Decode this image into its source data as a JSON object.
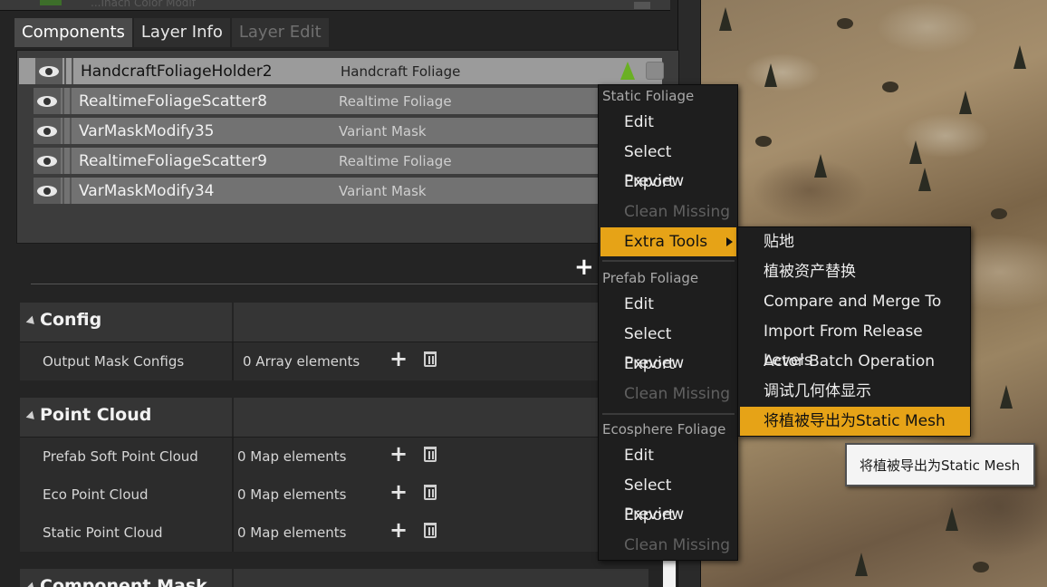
{
  "topbar": {
    "ghost_text": "...Inach Color Modif"
  },
  "tabs": [
    {
      "label": "Components",
      "state": "active"
    },
    {
      "label": "Layer Info",
      "state": "normal"
    },
    {
      "label": "Layer Edit",
      "state": "disabled"
    }
  ],
  "components": [
    {
      "name": "HandcraftFoliageHolder2",
      "type": "Handcraft Foliage",
      "selected": true
    },
    {
      "name": "RealtimeFoliageScatter8",
      "type": "Realtime Foliage"
    },
    {
      "name": "VarMaskModify35",
      "type": "Variant Mask"
    },
    {
      "name": "RealtimeFoliageScatter9",
      "type": "Realtime Foliage"
    },
    {
      "name": "VarMaskModify34",
      "type": "Variant Mask"
    }
  ],
  "sections": {
    "config": {
      "title": "Config",
      "rows": [
        {
          "label": "Output Mask Configs",
          "value": "0 Array elements"
        }
      ]
    },
    "point_cloud": {
      "title": "Point Cloud",
      "rows": [
        {
          "label": "Prefab Soft Point Cloud",
          "value": "0 Map elements"
        },
        {
          "label": "Eco Point Cloud",
          "value": "0 Map elements"
        },
        {
          "label": "Static Point Cloud",
          "value": "0 Map elements"
        }
      ]
    },
    "component_mask": {
      "title": "Component Mask"
    }
  },
  "context_menu": {
    "static_foliage": {
      "header": "Static Foliage",
      "items": [
        "Edit",
        "Select Preview",
        "Export",
        "Clean Missing",
        "Extra Tools"
      ]
    },
    "prefab_foliage": {
      "header": "Prefab Foliage",
      "items": [
        "Edit",
        "Select Preview",
        "Export",
        "Clean Missing"
      ]
    },
    "ecosphere_foliage": {
      "header": "Ecosphere Foliage",
      "items": [
        "Edit",
        "Select Preview",
        "Export",
        "Clean Missing"
      ]
    }
  },
  "submenu": {
    "items": [
      "贴地",
      "植被资产替换",
      "Compare and Merge To",
      "Import From Release Levels",
      "Actor Batch Operation",
      "调试几何体显示",
      "将植被导出为Static Mesh"
    ]
  },
  "tooltip": {
    "text": "将植被导出为Static Mesh"
  },
  "colors": {
    "accent": "#e6a317",
    "panel": "#242424",
    "menu": "#1e1e1e"
  }
}
